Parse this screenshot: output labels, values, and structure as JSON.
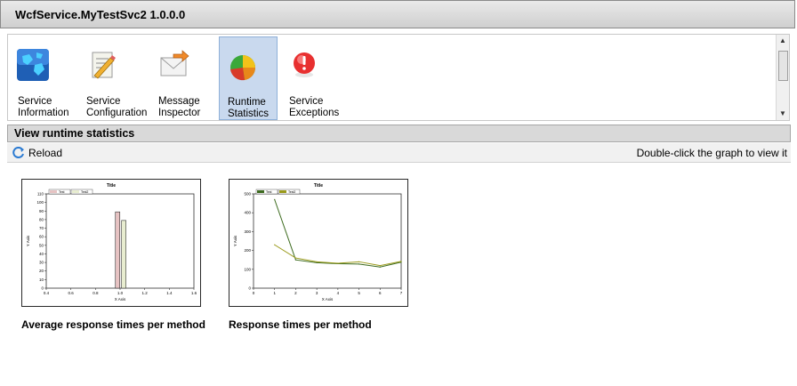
{
  "window": {
    "title": "WcfService.MyTestSvc2 1.0.0.0"
  },
  "toolbar": {
    "items": [
      {
        "label": "Service\nInformation",
        "icon": "globe-icon"
      },
      {
        "label": "Service\nConfiguration",
        "icon": "config-document-icon"
      },
      {
        "label": "Message\nInspector",
        "icon": "envelope-icon"
      },
      {
        "label": "Runtime\nStatistics",
        "icon": "pie-chart-icon",
        "selected": true
      },
      {
        "label": "Service\nExceptions",
        "icon": "exclamation-icon"
      }
    ]
  },
  "section": {
    "title": "View runtime statistics"
  },
  "actions": {
    "reload_label": "Reload",
    "hint": "Double-click the graph to view it"
  },
  "graphs": [
    {
      "caption": "Average response times per method"
    },
    {
      "caption": "Response times per method"
    }
  ],
  "chart_data": [
    {
      "type": "bar",
      "title": "Title",
      "xlabel": "X Axis",
      "ylabel": "Y Axis",
      "xlim": [
        0.4,
        1.6
      ],
      "ylim": [
        0,
        110
      ],
      "x_ticks": [
        "0.4",
        "0.6",
        "0.8",
        "1.0",
        "1.2",
        "1.4",
        "1.6"
      ],
      "y_ticks": [
        "0",
        "10",
        "20",
        "30",
        "40",
        "50",
        "60",
        "70",
        "80",
        "90",
        "100",
        "110"
      ],
      "series": [
        {
          "name": "Test",
          "color": "#e7c3c3",
          "x": [
            0.98
          ],
          "values": [
            89
          ]
        },
        {
          "name": "Test2",
          "color": "#e8edd0",
          "x": [
            1.03
          ],
          "values": [
            79
          ]
        }
      ],
      "legend": "top-left"
    },
    {
      "type": "line",
      "title": "Title",
      "xlabel": "X Axis",
      "ylabel": "Y Axis",
      "xlim": [
        0,
        7
      ],
      "ylim": [
        0,
        500
      ],
      "x_ticks": [
        "0",
        "1",
        "2",
        "3",
        "4",
        "5",
        "6",
        "7"
      ],
      "y_ticks": [
        "0",
        "100",
        "200",
        "300",
        "400",
        "500"
      ],
      "series": [
        {
          "name": "Test",
          "color": "#3d6b1f",
          "x": [
            1,
            2,
            3,
            4,
            5,
            6,
            7
          ],
          "values": [
            470,
            150,
            135,
            130,
            128,
            112,
            138
          ]
        },
        {
          "name": "Test2",
          "color": "#9a9a1a",
          "x": [
            1,
            2,
            3,
            4,
            5,
            6,
            7
          ],
          "values": [
            230,
            160,
            140,
            132,
            140,
            120,
            142
          ]
        }
      ],
      "legend": "top-left"
    }
  ]
}
